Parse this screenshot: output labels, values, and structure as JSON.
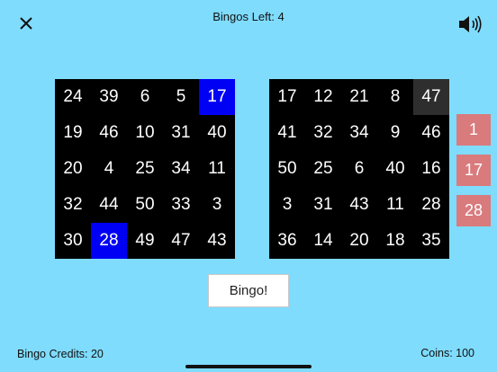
{
  "header": {
    "bingos_left": "Bingos Left: 4",
    "close_glyph": "X"
  },
  "boards": [
    {
      "cells": [
        "24",
        "39",
        "6",
        "5",
        "17",
        "19",
        "46",
        "10",
        "31",
        "40",
        "20",
        "4",
        "25",
        "34",
        "11",
        "32",
        "44",
        "50",
        "33",
        "3",
        "30",
        "28",
        "49",
        "47",
        "43"
      ],
      "marked": [
        4,
        21
      ],
      "highlight": []
    },
    {
      "cells": [
        "17",
        "12",
        "21",
        "8",
        "47",
        "41",
        "32",
        "34",
        "9",
        "46",
        "50",
        "25",
        "6",
        "40",
        "16",
        "3",
        "31",
        "43",
        "11",
        "28",
        "36",
        "14",
        "20",
        "18",
        "35"
      ],
      "marked": [],
      "highlight": [
        4
      ]
    }
  ],
  "called_numbers": [
    "1",
    "17",
    "28"
  ],
  "bingo_button_label": "Bingo!",
  "footer": {
    "credits": "Bingo Credits: 20",
    "coins": "Coins: 100"
  },
  "colors": {
    "background": "#7fdcfd",
    "marked_cell": "#0000f5",
    "called_ball": "#d97a7d"
  }
}
